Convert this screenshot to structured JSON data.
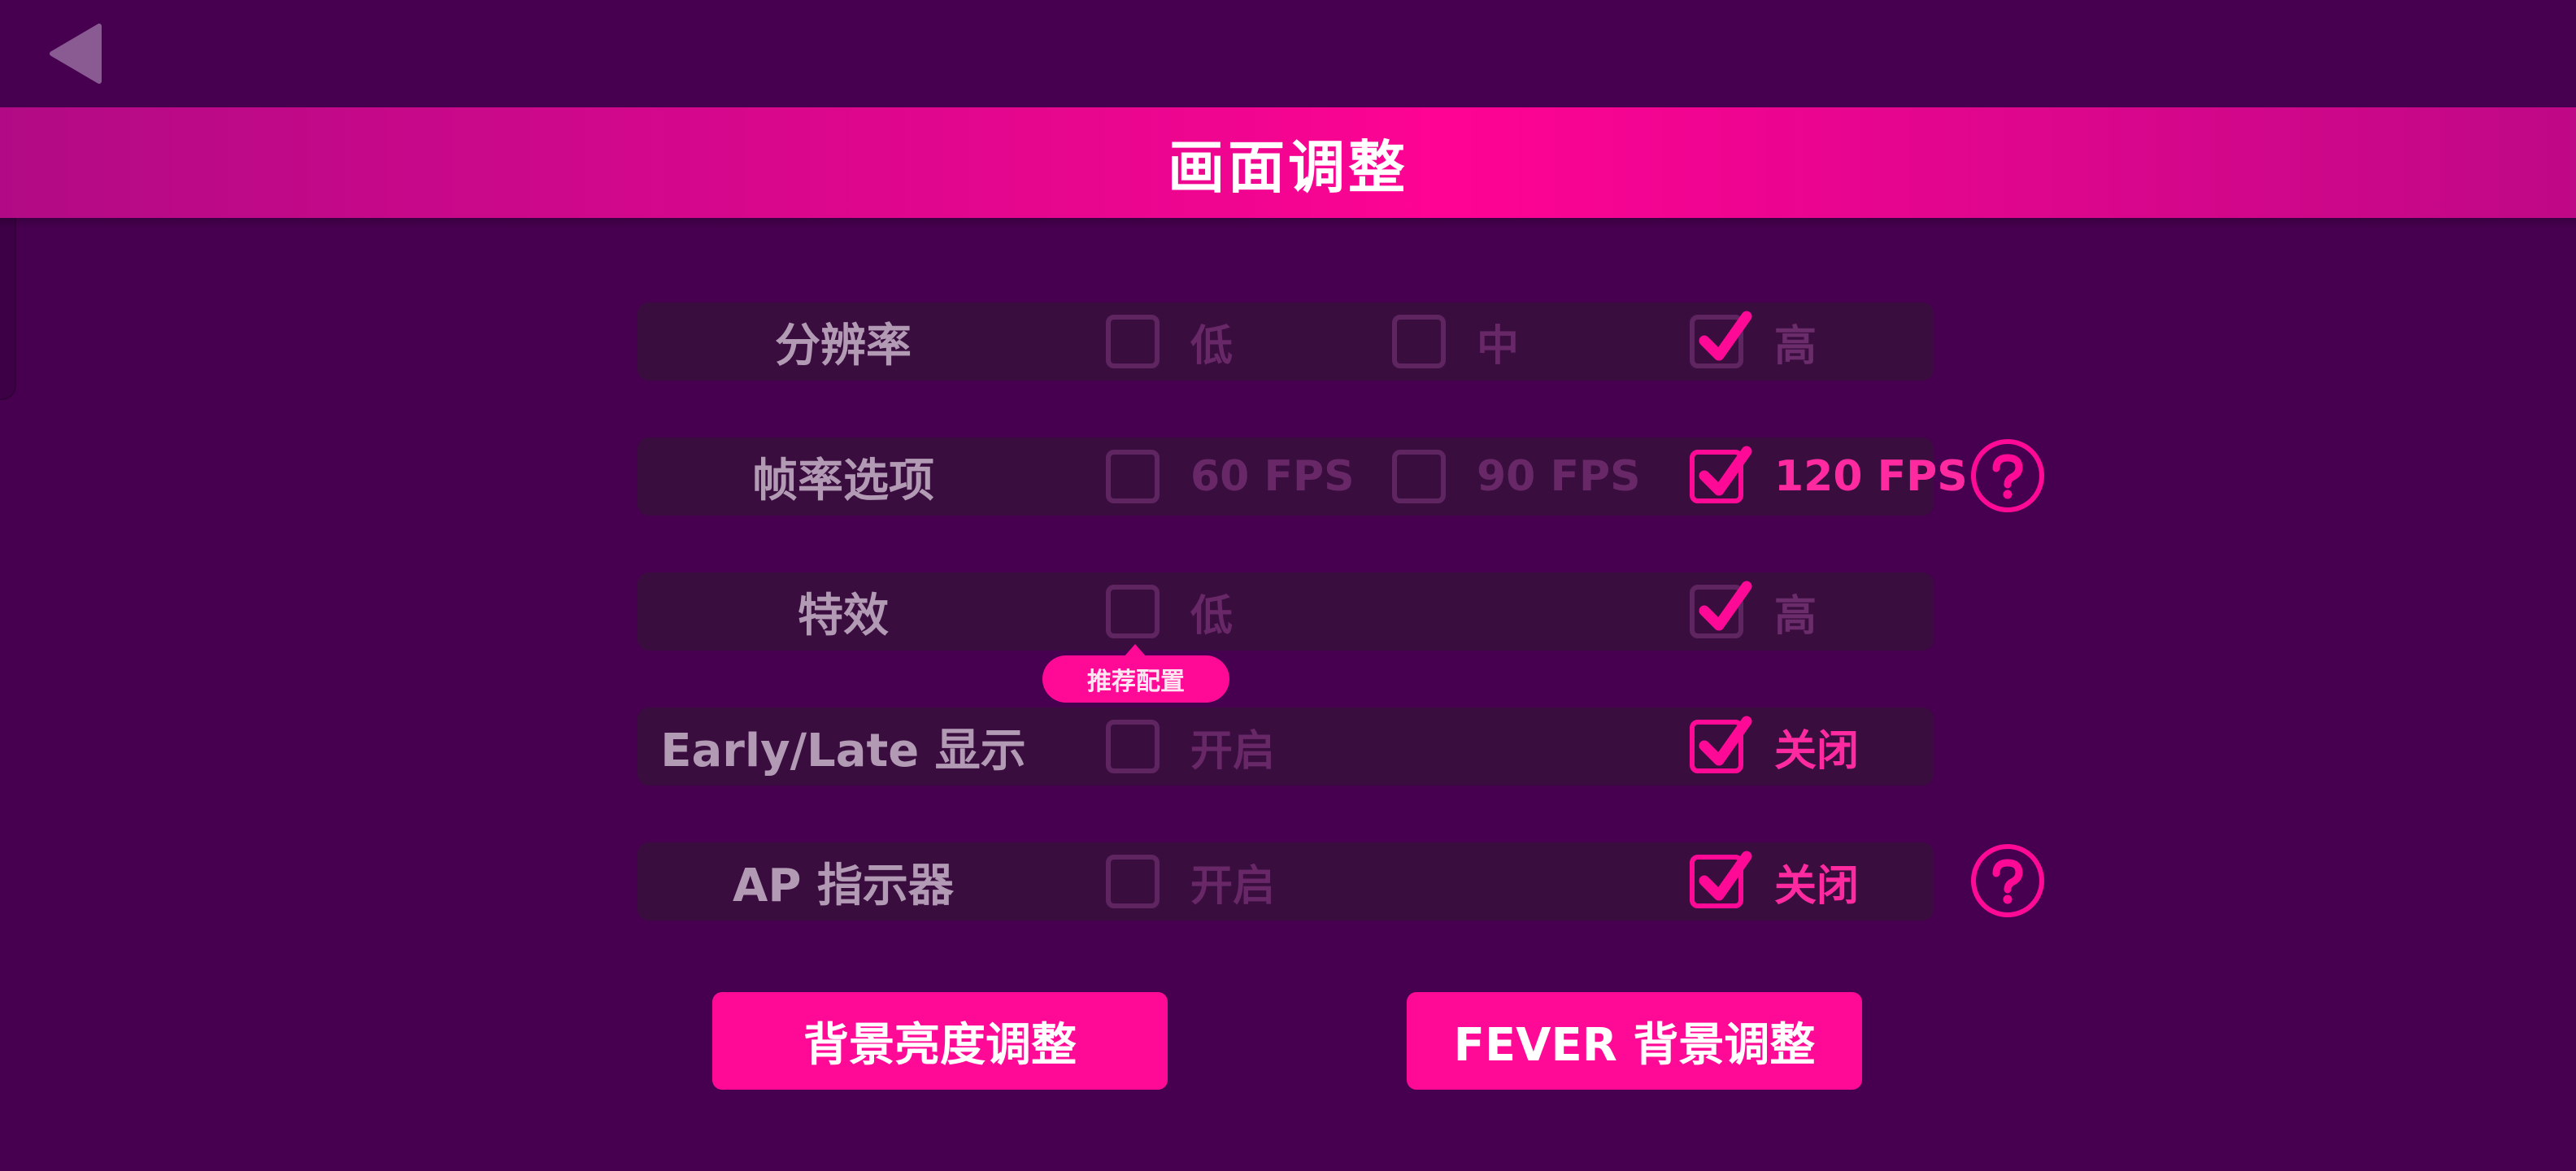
{
  "header": {
    "title": "画面调整"
  },
  "colors": {
    "background": "#47004f",
    "accent": "#ff0a96",
    "row_bg": "#3a0d3f",
    "dim": "#682868",
    "label": "#b29ab5"
  },
  "settings": [
    {
      "label": "分辨率",
      "options": [
        {
          "label": "低",
          "checked": false
        },
        {
          "label": "中",
          "checked": false
        },
        {
          "label": "高",
          "checked": true
        }
      ],
      "help": false
    },
    {
      "label": "帧率选项",
      "options": [
        {
          "label": "60 FPS",
          "checked": false
        },
        {
          "label": "90 FPS",
          "checked": false
        },
        {
          "label": "120 FPS",
          "checked": true
        }
      ],
      "help": true
    },
    {
      "label": "特效",
      "options": [
        {
          "label": "低",
          "checked": false
        },
        {
          "label": "高",
          "checked": true
        }
      ],
      "help": false
    },
    {
      "label": "Early/Late 显示",
      "options": [
        {
          "label": "开启",
          "checked": false
        },
        {
          "label": "关闭",
          "checked": true
        }
      ],
      "help": false
    },
    {
      "label": "AP 指示器",
      "options": [
        {
          "label": "开启",
          "checked": false
        },
        {
          "label": "关闭",
          "checked": true
        }
      ],
      "help": true
    }
  ],
  "recommend_badge": "推荐配置",
  "buttons": {
    "brightness": "背景亮度调整",
    "fever": "FEVER 背景调整"
  },
  "icons": {
    "back": "back-triangle-icon",
    "help": "question-mark-icon",
    "check": "checkmark-icon"
  }
}
